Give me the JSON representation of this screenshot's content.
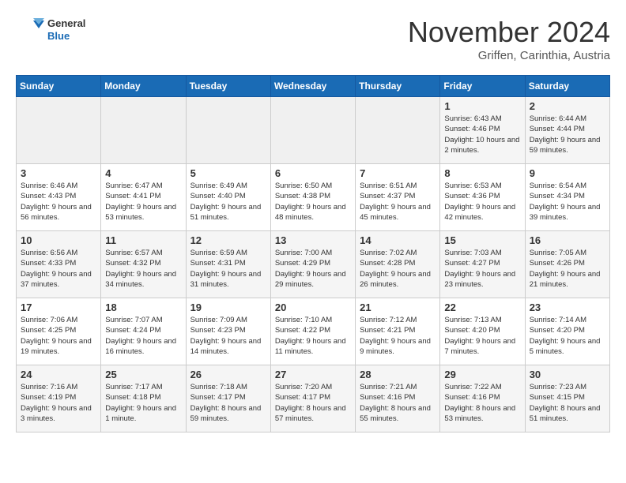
{
  "header": {
    "logo_text_general": "General",
    "logo_text_blue": "Blue",
    "month_title": "November 2024",
    "location": "Griffen, Carinthia, Austria"
  },
  "weekdays": [
    "Sunday",
    "Monday",
    "Tuesday",
    "Wednesday",
    "Thursday",
    "Friday",
    "Saturday"
  ],
  "days": [
    {
      "date": "",
      "sunrise": "",
      "sunset": "",
      "daylight": ""
    },
    {
      "date": "",
      "sunrise": "",
      "sunset": "",
      "daylight": ""
    },
    {
      "date": "",
      "sunrise": "",
      "sunset": "",
      "daylight": ""
    },
    {
      "date": "",
      "sunrise": "",
      "sunset": "",
      "daylight": ""
    },
    {
      "date": "",
      "sunrise": "",
      "sunset": "",
      "daylight": ""
    },
    {
      "date": "1",
      "sunrise": "Sunrise: 6:43 AM",
      "sunset": "Sunset: 4:46 PM",
      "daylight": "Daylight: 10 hours and 2 minutes."
    },
    {
      "date": "2",
      "sunrise": "Sunrise: 6:44 AM",
      "sunset": "Sunset: 4:44 PM",
      "daylight": "Daylight: 9 hours and 59 minutes."
    },
    {
      "date": "3",
      "sunrise": "Sunrise: 6:46 AM",
      "sunset": "Sunset: 4:43 PM",
      "daylight": "Daylight: 9 hours and 56 minutes."
    },
    {
      "date": "4",
      "sunrise": "Sunrise: 6:47 AM",
      "sunset": "Sunset: 4:41 PM",
      "daylight": "Daylight: 9 hours and 53 minutes."
    },
    {
      "date": "5",
      "sunrise": "Sunrise: 6:49 AM",
      "sunset": "Sunset: 4:40 PM",
      "daylight": "Daylight: 9 hours and 51 minutes."
    },
    {
      "date": "6",
      "sunrise": "Sunrise: 6:50 AM",
      "sunset": "Sunset: 4:38 PM",
      "daylight": "Daylight: 9 hours and 48 minutes."
    },
    {
      "date": "7",
      "sunrise": "Sunrise: 6:51 AM",
      "sunset": "Sunset: 4:37 PM",
      "daylight": "Daylight: 9 hours and 45 minutes."
    },
    {
      "date": "8",
      "sunrise": "Sunrise: 6:53 AM",
      "sunset": "Sunset: 4:36 PM",
      "daylight": "Daylight: 9 hours and 42 minutes."
    },
    {
      "date": "9",
      "sunrise": "Sunrise: 6:54 AM",
      "sunset": "Sunset: 4:34 PM",
      "daylight": "Daylight: 9 hours and 39 minutes."
    },
    {
      "date": "10",
      "sunrise": "Sunrise: 6:56 AM",
      "sunset": "Sunset: 4:33 PM",
      "daylight": "Daylight: 9 hours and 37 minutes."
    },
    {
      "date": "11",
      "sunrise": "Sunrise: 6:57 AM",
      "sunset": "Sunset: 4:32 PM",
      "daylight": "Daylight: 9 hours and 34 minutes."
    },
    {
      "date": "12",
      "sunrise": "Sunrise: 6:59 AM",
      "sunset": "Sunset: 4:31 PM",
      "daylight": "Daylight: 9 hours and 31 minutes."
    },
    {
      "date": "13",
      "sunrise": "Sunrise: 7:00 AM",
      "sunset": "Sunset: 4:29 PM",
      "daylight": "Daylight: 9 hours and 29 minutes."
    },
    {
      "date": "14",
      "sunrise": "Sunrise: 7:02 AM",
      "sunset": "Sunset: 4:28 PM",
      "daylight": "Daylight: 9 hours and 26 minutes."
    },
    {
      "date": "15",
      "sunrise": "Sunrise: 7:03 AM",
      "sunset": "Sunset: 4:27 PM",
      "daylight": "Daylight: 9 hours and 23 minutes."
    },
    {
      "date": "16",
      "sunrise": "Sunrise: 7:05 AM",
      "sunset": "Sunset: 4:26 PM",
      "daylight": "Daylight: 9 hours and 21 minutes."
    },
    {
      "date": "17",
      "sunrise": "Sunrise: 7:06 AM",
      "sunset": "Sunset: 4:25 PM",
      "daylight": "Daylight: 9 hours and 19 minutes."
    },
    {
      "date": "18",
      "sunrise": "Sunrise: 7:07 AM",
      "sunset": "Sunset: 4:24 PM",
      "daylight": "Daylight: 9 hours and 16 minutes."
    },
    {
      "date": "19",
      "sunrise": "Sunrise: 7:09 AM",
      "sunset": "Sunset: 4:23 PM",
      "daylight": "Daylight: 9 hours and 14 minutes."
    },
    {
      "date": "20",
      "sunrise": "Sunrise: 7:10 AM",
      "sunset": "Sunset: 4:22 PM",
      "daylight": "Daylight: 9 hours and 11 minutes."
    },
    {
      "date": "21",
      "sunrise": "Sunrise: 7:12 AM",
      "sunset": "Sunset: 4:21 PM",
      "daylight": "Daylight: 9 hours and 9 minutes."
    },
    {
      "date": "22",
      "sunrise": "Sunrise: 7:13 AM",
      "sunset": "Sunset: 4:20 PM",
      "daylight": "Daylight: 9 hours and 7 minutes."
    },
    {
      "date": "23",
      "sunrise": "Sunrise: 7:14 AM",
      "sunset": "Sunset: 4:20 PM",
      "daylight": "Daylight: 9 hours and 5 minutes."
    },
    {
      "date": "24",
      "sunrise": "Sunrise: 7:16 AM",
      "sunset": "Sunset: 4:19 PM",
      "daylight": "Daylight: 9 hours and 3 minutes."
    },
    {
      "date": "25",
      "sunrise": "Sunrise: 7:17 AM",
      "sunset": "Sunset: 4:18 PM",
      "daylight": "Daylight: 9 hours and 1 minute."
    },
    {
      "date": "26",
      "sunrise": "Sunrise: 7:18 AM",
      "sunset": "Sunset: 4:17 PM",
      "daylight": "Daylight: 8 hours and 59 minutes."
    },
    {
      "date": "27",
      "sunrise": "Sunrise: 7:20 AM",
      "sunset": "Sunset: 4:17 PM",
      "daylight": "Daylight: 8 hours and 57 minutes."
    },
    {
      "date": "28",
      "sunrise": "Sunrise: 7:21 AM",
      "sunset": "Sunset: 4:16 PM",
      "daylight": "Daylight: 8 hours and 55 minutes."
    },
    {
      "date": "29",
      "sunrise": "Sunrise: 7:22 AM",
      "sunset": "Sunset: 4:16 PM",
      "daylight": "Daylight: 8 hours and 53 minutes."
    },
    {
      "date": "30",
      "sunrise": "Sunrise: 7:23 AM",
      "sunset": "Sunset: 4:15 PM",
      "daylight": "Daylight: 8 hours and 51 minutes."
    }
  ]
}
